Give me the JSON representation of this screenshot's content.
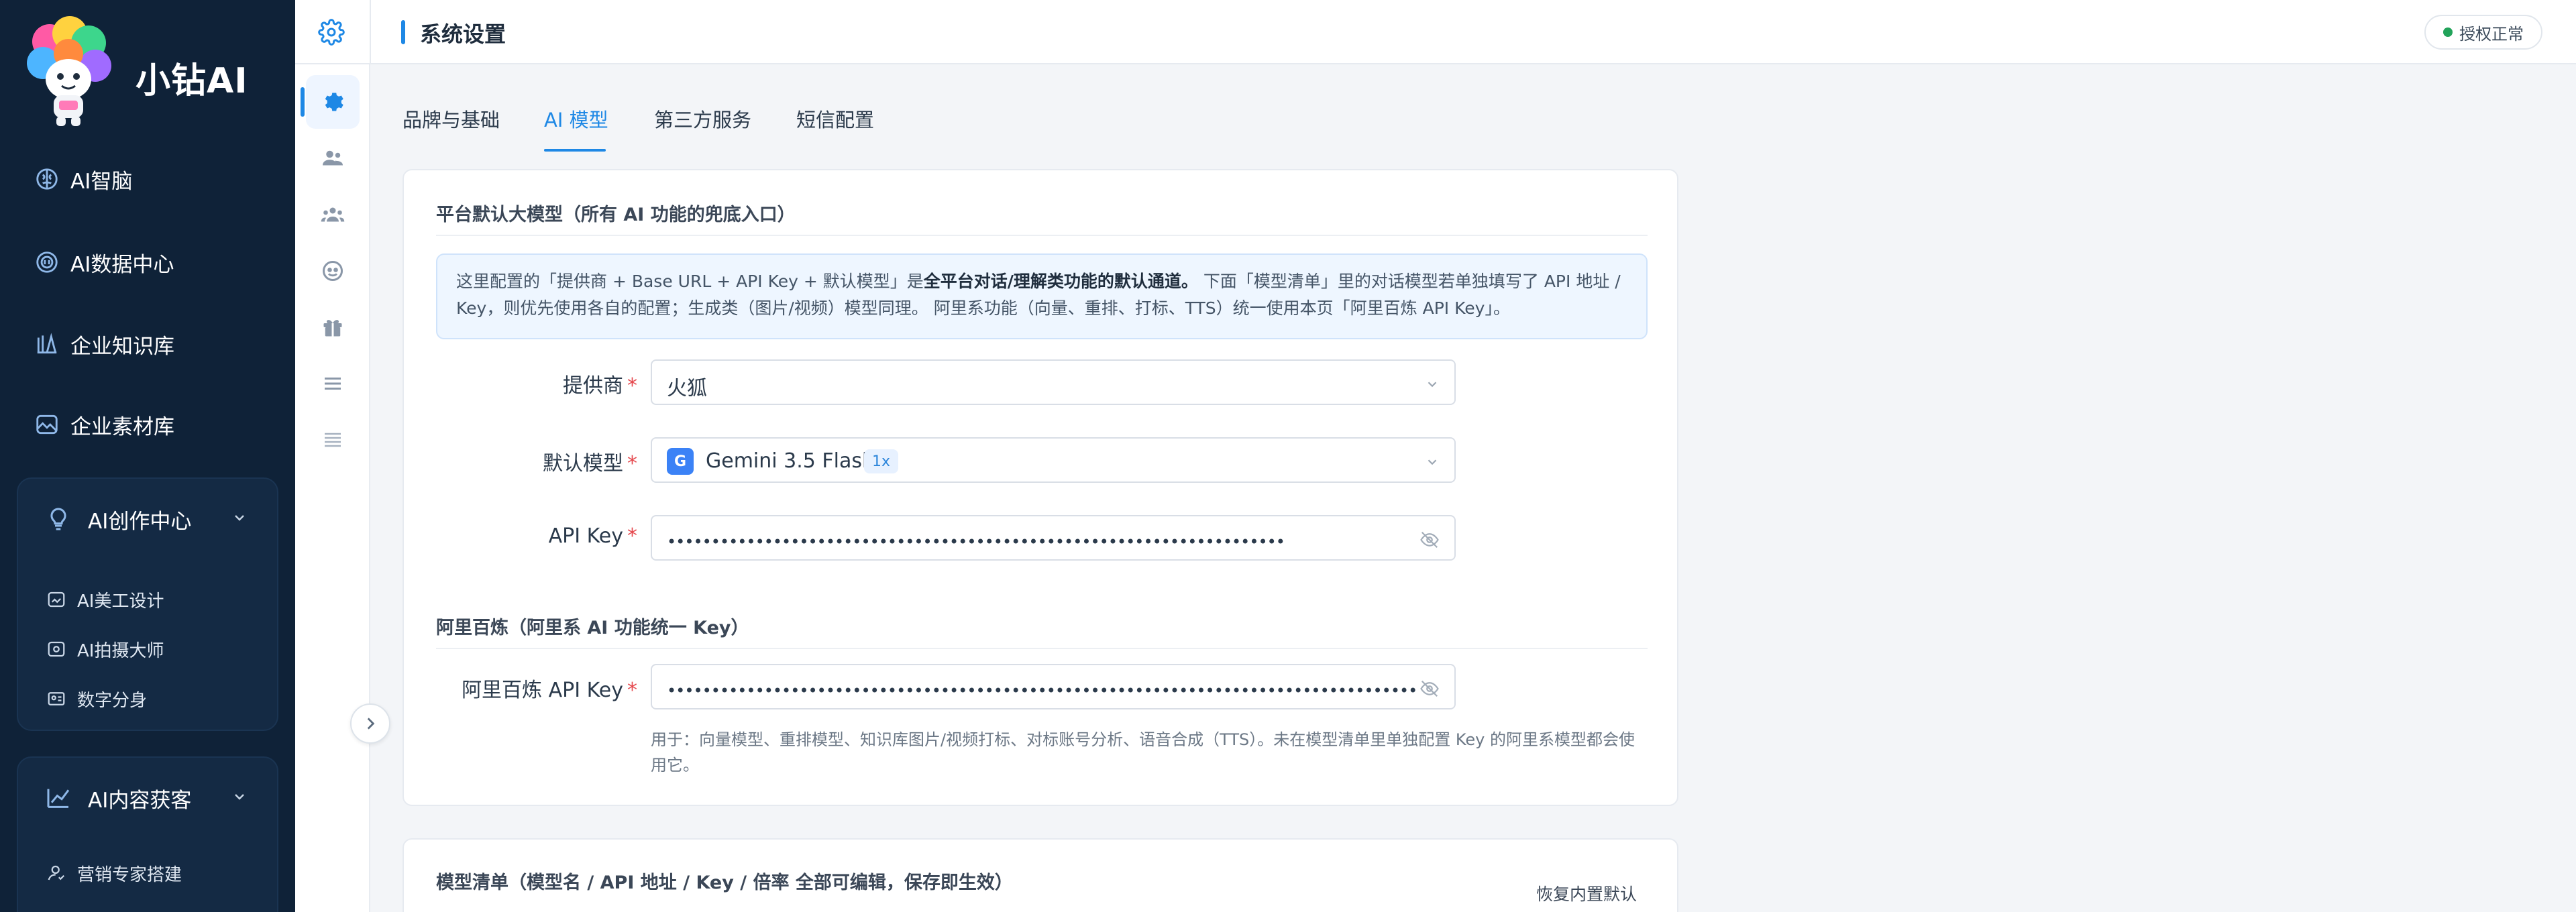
{
  "brand": {
    "name": "小钻AI",
    "logo_icon": "mascot-logo-icon"
  },
  "sidebar": {
    "nav": [
      {
        "label": "AI智脑",
        "icon": "brain-icon"
      },
      {
        "label": "AI数据中心",
        "icon": "data-center-icon"
      },
      {
        "label": "企业知识库",
        "icon": "library-icon"
      },
      {
        "label": "企业素材库",
        "icon": "image-library-icon"
      }
    ],
    "groups": [
      {
        "label": "AI创作中心",
        "icon": "bulb-icon",
        "items": [
          {
            "label": "AI美工设计",
            "icon": "design-icon"
          },
          {
            "label": "AI拍摄大师",
            "icon": "camera-icon"
          },
          {
            "label": "数字分身",
            "icon": "id-card-icon"
          }
        ]
      },
      {
        "label": "AI内容获客",
        "icon": "trend-icon",
        "items": [
          {
            "label": "营销专家搭建",
            "icon": "user-expert-icon"
          }
        ]
      }
    ]
  },
  "header": {
    "title": "系统设置",
    "status": "授权正常",
    "status_color": "#22a35a"
  },
  "tabs": [
    "品牌与基础",
    "AI 模型",
    "第三方服务",
    "短信配置"
  ],
  "active_tab": "AI 模型",
  "platform": {
    "section_title": "平台默认大模型（所有 AI 功能的兜底入口）",
    "info_part1": "这里配置的「提供商 + Base URL + API Key + 默认模型」是",
    "info_bold": "全平台对话/理解类功能的默认通道。",
    "info_part2": "下面「模型清单」里的对话模型若单独填写了 API 地址 / Key，则优先使用各自的配置；生成类（图片/视频）模型同理。 阿里系功能（向量、重排、打标、TTS）统一使用本页「阿里百炼 API Key」。",
    "provider_label": "提供商",
    "provider_value": "火狐",
    "model_label": "默认模型",
    "model_badge": "G",
    "model_value": "Gemini 3.5 Flash",
    "model_multiplier": "1x",
    "apikey_label": "API Key",
    "apikey_mask": "••••••••••••••••••••••••••••••••••••••••••••••••••••••••••••••••••••••"
  },
  "bailian": {
    "section_title": "阿里百炼（阿里系 AI 功能统一 Key）",
    "apikey_label": "阿里百炼 API Key",
    "apikey_mask": "••••••••••••••••••••••••••••••••••••••••••••••••••••••••••••••••••••••••••••••••••••••••••",
    "help": "用于：向量模型、重排模型、知识库图片/视频打标、对标账号分析、语音合成（TTS）。未在模型清单里单独配置 Key 的阿里系模型都会使用它。"
  },
  "models": {
    "section_title": "模型清单（模型名 / API 地址 / Key / 倍率 全部可编辑，保存即生效）",
    "restore_label": "恢复内置默认"
  },
  "accent_color": "#1e88e5",
  "sidebar_color": "#0f2238"
}
